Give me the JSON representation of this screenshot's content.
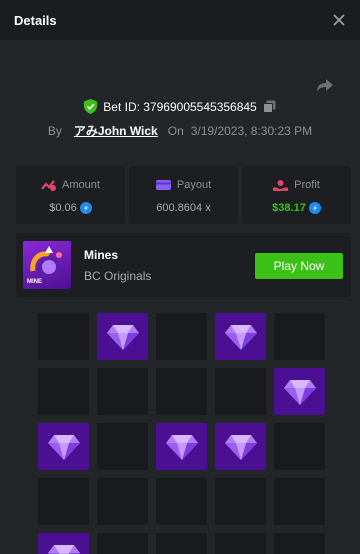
{
  "header": {
    "title": "Details"
  },
  "bet": {
    "id_text": "Bet ID: 37969005545356845",
    "by_label": "By",
    "username": "アみJohn Wick",
    "on_label": "On",
    "datetime": "3/19/2023, 8:30:23 PM"
  },
  "stats": {
    "amount": {
      "label": "Amount",
      "value": "$0.06"
    },
    "payout": {
      "label": "Payout",
      "value": "600.8604 x"
    },
    "profit": {
      "label": "Profit",
      "value": "$38.17"
    }
  },
  "game": {
    "thumb_text": "MINE",
    "name": "Mines",
    "provider": "BC Originals",
    "play_label": "Play Now"
  },
  "colors": {
    "accent_green": "#3bc117",
    "gem_tile": "#4b0f93",
    "empty_tile": "#181a1d"
  },
  "board": {
    "tiles": [
      "empty",
      "gem",
      "empty",
      "gem",
      "empty",
      "empty",
      "empty",
      "empty",
      "empty",
      "gem",
      "gem",
      "empty",
      "gem",
      "gem",
      "empty",
      "empty",
      "empty",
      "empty",
      "empty",
      "empty",
      "gem",
      "empty",
      "empty",
      "empty",
      "empty"
    ]
  }
}
